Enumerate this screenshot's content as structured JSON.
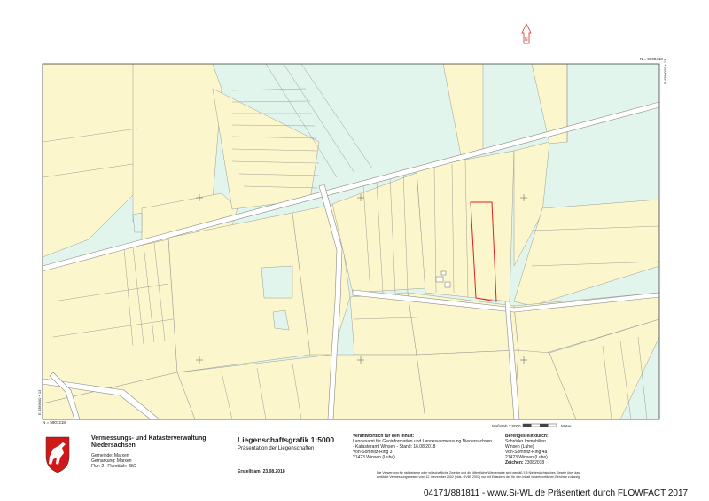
{
  "map": {
    "coord_top_right": "N = 5908418",
    "coord_bottom_left": "N = 5907218",
    "coord_right_vertical": "E 4390000 + 13",
    "coord_left_vertical": "E 4389000 + 13",
    "north_label": "N",
    "scale_label": "Maßstab 1:5000",
    "scale_unit": "Meter",
    "colors": {
      "field_yellow": "#fbf6cc",
      "meadow_green": "#e2f5ec",
      "selected_parcel": "#e02020",
      "road": "#ffffff",
      "line": "#777777"
    }
  },
  "footer_panel": {
    "org_line1": "Vermessungs- und Katasterverwaltung",
    "org_line2": "Niedersachsen",
    "gemeinde_label": "Gemeinde:",
    "gemeinde_value": "Marxen",
    "gemarkung_label": "Gemarkung:",
    "gemarkung_value": "Marxen",
    "flur_label": "Flur:",
    "flur_value": "2",
    "flurstueck_label": "Flurstück:",
    "flurstueck_value": "48/2",
    "title": "Liegenschaftsgrafik 1:5000",
    "subtitle": "Präsentation der Liegenschaften",
    "created": "Erstellt am: 23.08.2018",
    "resp_heading": "Verantwortlich für den Inhalt:",
    "resp_lines": [
      "Landesamt für Geoinformation und Landesvermessung Niedersachsen",
      "- Katasteramt Winsen - Stand: 16.08.2018",
      "Von-Somnitz-Ring 3",
      "21423 Winsen (Luhe)"
    ],
    "prov_heading": "Bereitgestellt durch:",
    "prov_lines": [
      "Schröder Immobilien",
      "Winsen (Luhe)",
      "Von-Somnitz-Ring 4a",
      "21423 Winsen (Luhe)"
    ],
    "ref_label": "Zeichen:",
    "ref_value": "23082018",
    "legal_line1": "Die Verwertung für nichteigene oder wirtschaftliche Zwecke und die öffentliche Wiedergabe sind gemäß § 5 Niedersächsisches Gesetz über das",
    "legal_line2": "amtliche Vermessungswesen vom 12. Dezember 2002 (Nds. GVBl. 2003) nur mit Erlaubnis der für den Inhalt verantwortlichen Behörde zulässig."
  },
  "watermark": "04171/881811 - www.Si-WL.de Präsentiert durch FLOWFACT 2017"
}
